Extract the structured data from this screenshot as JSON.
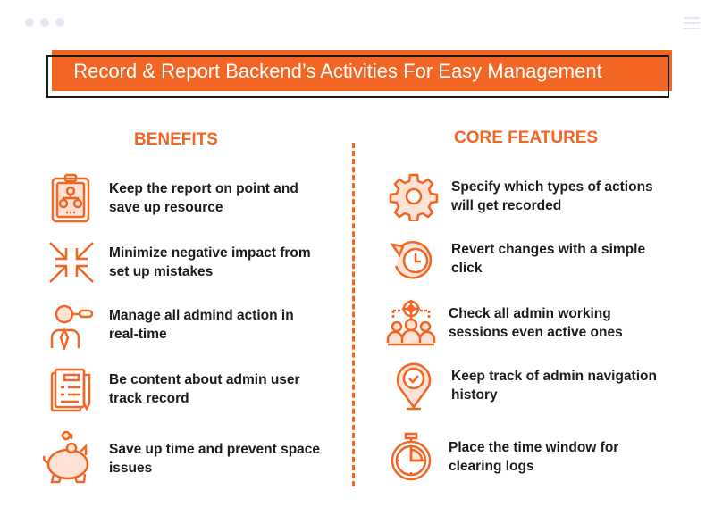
{
  "window": {
    "controls": [
      "dot",
      "dot",
      "dot"
    ],
    "menu_icon": "hamburger-icon"
  },
  "banner": {
    "title": "Record & Report Backend’s Activities For Easy Management"
  },
  "colors": {
    "accent": "#f26522",
    "text": "#1c1c1c",
    "frame": "#1a1a1a"
  },
  "benefits": {
    "title": "BENEFITS",
    "items": [
      {
        "icon": "clipboard-org-chart-icon",
        "text": "Keep the report on point and save up resource"
      },
      {
        "icon": "arrows-inward-icon",
        "text": "Minimize negative impact from set up mistakes"
      },
      {
        "icon": "admin-search-icon",
        "text": "Manage all admind action in real-time"
      },
      {
        "icon": "document-pen-icon",
        "text": "Be content about admin user track record"
      },
      {
        "icon": "piggy-bank-icon",
        "text": "Save up time and prevent space issues"
      }
    ]
  },
  "core_features": {
    "title": "CORE FEATURES",
    "items": [
      {
        "icon": "gear-icon",
        "text": "Specify which types of actions will get recorded"
      },
      {
        "icon": "revert-clock-icon",
        "text": "Revert changes with a simple click"
      },
      {
        "icon": "target-users-icon",
        "text": "Check all admin working sessions even active ones"
      },
      {
        "icon": "location-check-icon",
        "text": "Keep track of admin navigation history"
      },
      {
        "icon": "stopwatch-icon",
        "text": "Place the time window for clearing logs"
      }
    ]
  }
}
